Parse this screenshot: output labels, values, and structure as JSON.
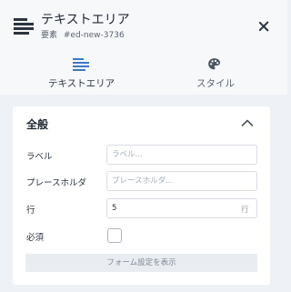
{
  "header": {
    "title": "テキストエリア",
    "subtitle_prefix": "要素",
    "element_id": "#ed-new-3736",
    "icon": "text-lines-icon",
    "close_icon": "close-icon"
  },
  "tabs": [
    {
      "label": "テキストエリア",
      "icon": "text-lines-icon",
      "active": true
    },
    {
      "label": "スタイル",
      "icon": "palette-icon",
      "active": false
    }
  ],
  "section": {
    "title": "全般",
    "collapse_icon": "chevron-up-icon"
  },
  "fields": {
    "label": {
      "label": "ラベル",
      "value": "",
      "placeholder": "ラベル..."
    },
    "placeholder": {
      "label": "プレースホルダ",
      "value": "",
      "placeholder": "プレースホルダ..."
    },
    "rows": {
      "label": "行",
      "value": "5",
      "unit": "行"
    },
    "required": {
      "label": "必須",
      "checked": false
    }
  },
  "footer": {
    "button_label": "フォーム設定を表示"
  },
  "colors": {
    "accent": "#3e79c9",
    "background": "#eef1f5",
    "text": "#2b3440"
  }
}
